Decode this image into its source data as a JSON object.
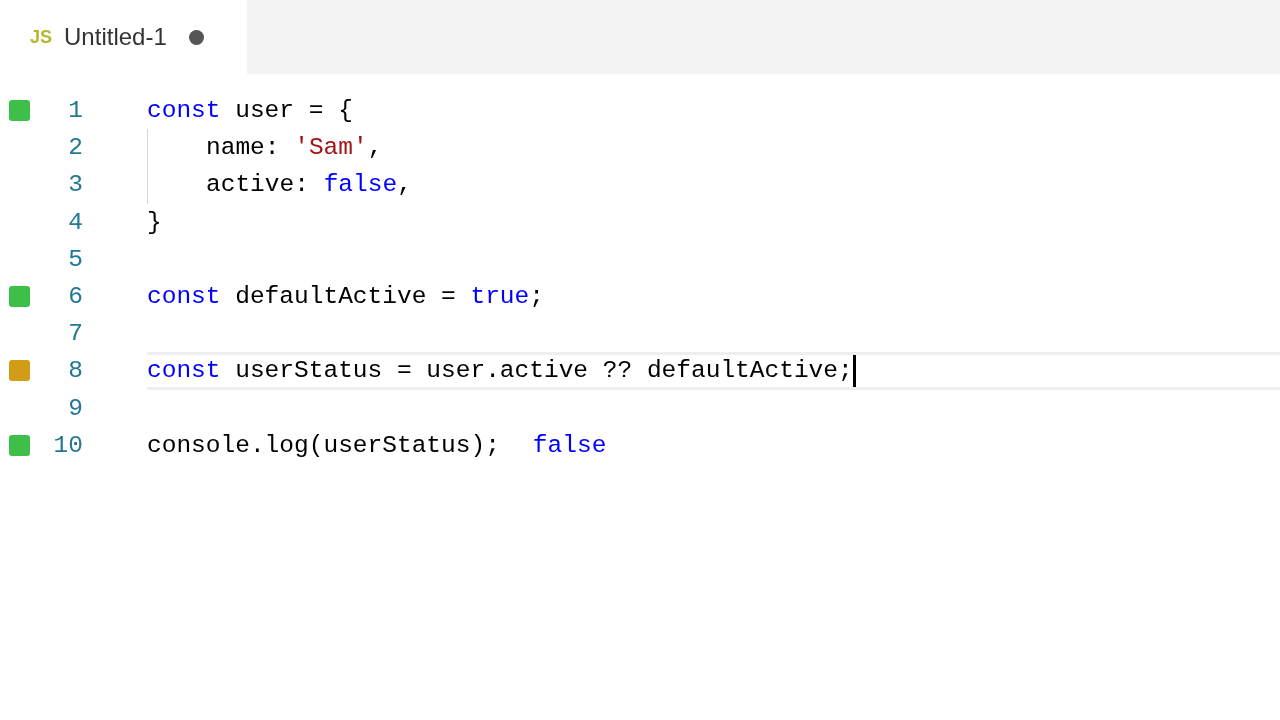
{
  "tab": {
    "language_badge": "JS",
    "title": "Untitled-1",
    "modified": true,
    "selected": true
  },
  "lines": [
    {
      "number": "1",
      "color": "#3ebf4a",
      "tokens": [
        {
          "kind": "keyword",
          "text": "const"
        },
        {
          "kind": "plain",
          "text": " user = {"
        }
      ]
    },
    {
      "number": "2",
      "indented": true,
      "tokens": [
        {
          "kind": "plain",
          "text": "name: "
        },
        {
          "kind": "string",
          "text": "'Sam'"
        },
        {
          "kind": "plain",
          "text": ","
        }
      ]
    },
    {
      "number": "3",
      "indented": true,
      "tokens": [
        {
          "kind": "plain",
          "text": "active: "
        },
        {
          "kind": "keyword",
          "text": "false"
        },
        {
          "kind": "plain",
          "text": ","
        }
      ]
    },
    {
      "number": "4",
      "tokens": [
        {
          "kind": "plain",
          "text": "}"
        }
      ]
    },
    {
      "number": "5"
    },
    {
      "number": "6",
      "color": "#3ebf4a",
      "tokens": [
        {
          "kind": "keyword",
          "text": "const"
        },
        {
          "kind": "plain",
          "text": " defaultActive = "
        },
        {
          "kind": "keyword",
          "text": "true"
        },
        {
          "kind": "plain",
          "text": ";"
        }
      ]
    },
    {
      "number": "7"
    },
    {
      "number": "8",
      "color": "#d19d17",
      "current": true,
      "tokens": [
        {
          "kind": "keyword",
          "text": "const"
        },
        {
          "kind": "plain",
          "text": " userStatus = user.active ?? defaultActive;"
        }
      ]
    },
    {
      "number": "9"
    },
    {
      "number": "10",
      "color": "#3ebf4a",
      "tokens": [
        {
          "kind": "plain",
          "text": "console.log(userStatus);"
        }
      ],
      "result": "false"
    }
  ]
}
